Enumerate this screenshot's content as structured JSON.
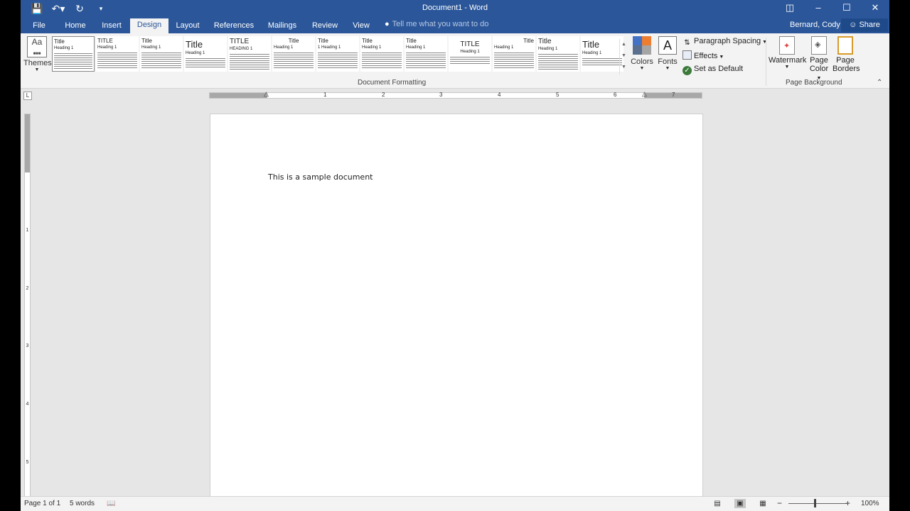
{
  "titlebar": {
    "title": "Document1 - Word",
    "qat": {
      "save_icon": "save-icon",
      "undo_icon": "undo-icon",
      "redo_icon": "redo-icon",
      "customize_icon": "customize-qat-icon"
    },
    "window_controls": [
      "ribbon-display-icon",
      "minimize-icon",
      "maximize-icon",
      "close-icon"
    ]
  },
  "tabs": [
    {
      "label": "File",
      "active": false
    },
    {
      "label": "Home",
      "active": false
    },
    {
      "label": "Insert",
      "active": false
    },
    {
      "label": "Design",
      "active": true
    },
    {
      "label": "Layout",
      "active": false
    },
    {
      "label": "References",
      "active": false
    },
    {
      "label": "Mailings",
      "active": false
    },
    {
      "label": "Review",
      "active": false
    },
    {
      "label": "View",
      "active": false
    }
  ],
  "tellme": {
    "placeholder": "Tell me what you want to do",
    "icon": "lightbulb-icon"
  },
  "user": {
    "name": "Bernard, Cody",
    "share_label": "Share"
  },
  "ribbon": {
    "themes_label": "Themes",
    "style_gallery": [
      {
        "title": "Title",
        "heading": "Heading 1"
      },
      {
        "title": "TITLE",
        "heading": "Heading 1"
      },
      {
        "title": "Title",
        "heading": "Heading 1"
      },
      {
        "title": "Title",
        "heading": "Heading 1"
      },
      {
        "title": "TITLE",
        "heading": "HEADING 1"
      },
      {
        "title": "Title",
        "heading": "Heading 1"
      },
      {
        "title": "Title",
        "heading": "1 Heading 1"
      },
      {
        "title": "Title",
        "heading": "Heading 1"
      },
      {
        "title": "Title",
        "heading": "Heading 1"
      },
      {
        "title": "TITLE",
        "heading": "Heading 1"
      },
      {
        "title": "Title",
        "heading": "Heading 1"
      },
      {
        "title": "Title",
        "heading": "Heading 1"
      },
      {
        "title": "Title",
        "heading": "Heading 1"
      }
    ],
    "document_formatting_label": "Document Formatting",
    "colors_label": "Colors",
    "fonts_label": "Fonts",
    "paragraph_spacing_label": "Paragraph Spacing",
    "effects_label": "Effects",
    "set_default_label": "Set as Default",
    "watermark_label": "Watermark",
    "page_color_label_1": "Page",
    "page_color_label_2": "Color",
    "page_borders_label_1": "Page",
    "page_borders_label_2": "Borders",
    "page_background_label": "Page Background",
    "swatch_colors": [
      "#4472c4",
      "#ed7d31",
      "#5b6f8f",
      "#a5a5a5"
    ]
  },
  "ruler": {
    "h_numbers": [
      "1",
      "2",
      "3",
      "4",
      "5",
      "6",
      "7"
    ],
    "v_numbers": [
      "1",
      "2",
      "3",
      "4",
      "5"
    ]
  },
  "document": {
    "text": "This is a sample document"
  },
  "status": {
    "page": "Page 1 of 1",
    "words": "5 words",
    "zoom": "100%"
  },
  "colors": {
    "brand": "#2b579a"
  }
}
